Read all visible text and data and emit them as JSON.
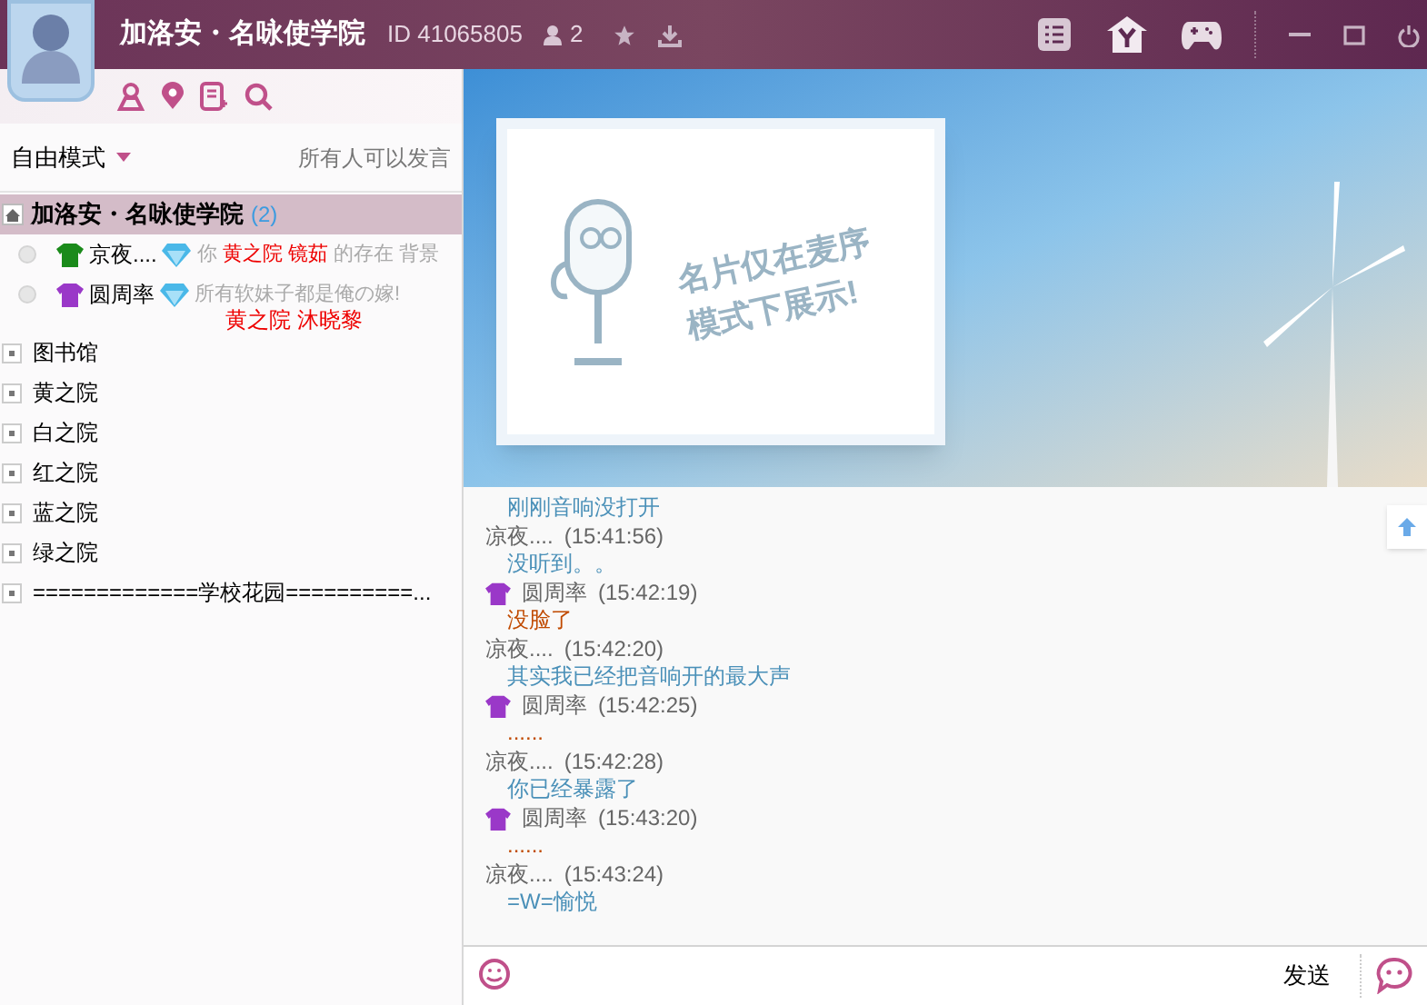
{
  "header": {
    "title": "加洛安・名咏使学院",
    "id": "ID 41065805",
    "online_count": "2"
  },
  "mode": {
    "label": "自由模式",
    "speak_rule": "所有人可以发言"
  },
  "channel_tree": {
    "root": {
      "name": "加洛安・名咏使学院",
      "count": "(2)",
      "expanded": true
    },
    "members": [
      {
        "name": "京夜....",
        "status": "你",
        "tag": "黄之院 镜茹",
        "status_end": "的存在 背景",
        "color": "#1a8a1a"
      },
      {
        "name": "圆周率",
        "status": "所有软妹子都是俺の嫁!",
        "tag": "黄之院 沐晓黎",
        "color": "#9a38c8"
      }
    ],
    "channels": [
      "图书馆",
      "黄之院",
      "白之院",
      "红之院",
      "蓝之院",
      "绿之院",
      "=============学校花园==========..."
    ]
  },
  "banner": {
    "card_text": "名片仅在麦序模式下展示!"
  },
  "chat": [
    {
      "text": "刚刚音响没打开",
      "color": "#4a90b8"
    },
    {
      "sender": "凉夜....",
      "time": "(15:41:56)",
      "vip": false,
      "text": "没听到。。",
      "color": "#4a90b8"
    },
    {
      "sender": "圆周率",
      "time": "(15:42:19)",
      "vip": true,
      "text": "没脸了",
      "color": "#c04a00"
    },
    {
      "sender": "凉夜....",
      "time": "(15:42:20)",
      "vip": false,
      "text": "其实我已经把音响开的最大声",
      "color": "#4a90b8"
    },
    {
      "sender": "圆周率",
      "time": "(15:42:25)",
      "vip": true,
      "text": "......",
      "color": "#c04a00"
    },
    {
      "sender": "凉夜....",
      "time": "(15:42:28)",
      "vip": false,
      "text": "你已经暴露了",
      "color": "#4a90b8"
    },
    {
      "sender": "圆周率",
      "time": "(15:43:20)",
      "vip": true,
      "text": "......",
      "color": "#c04a00"
    },
    {
      "sender": "凉夜....",
      "time": "(15:43:24)",
      "vip": false,
      "text": "=W=愉悦",
      "color": "#4a90b8"
    }
  ],
  "input": {
    "send_label": "发送"
  }
}
